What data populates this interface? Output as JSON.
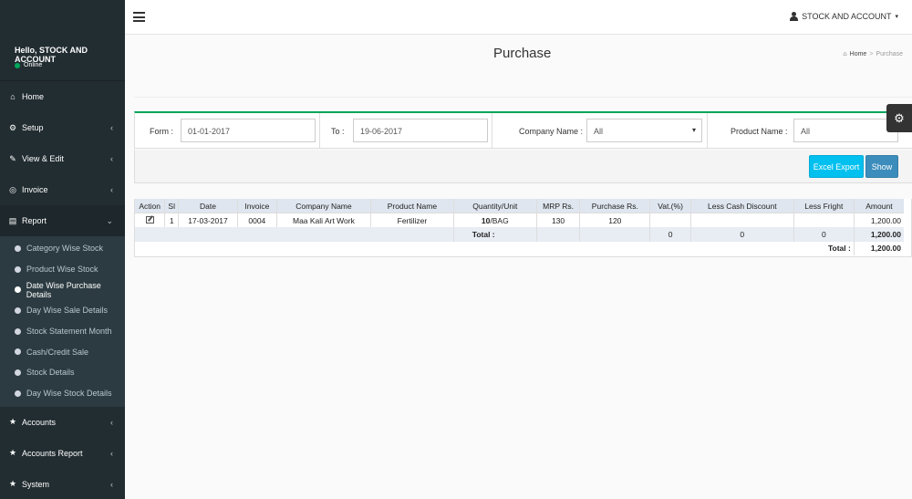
{
  "sidebar": {
    "greeting": "Hello, STOCK AND ACCOUNT",
    "status": "Online",
    "items": [
      {
        "label": "Home",
        "icon": "home-icon"
      },
      {
        "label": "Setup",
        "icon": "cogs-icon"
      },
      {
        "label": "View & Edit",
        "icon": "edit-icon"
      },
      {
        "label": "Invoice",
        "icon": "fingerprint-icon"
      },
      {
        "label": "Report",
        "icon": "file-icon"
      },
      {
        "label": "Accounts",
        "icon": "star-icon"
      },
      {
        "label": "Accounts Report",
        "icon": "star-icon"
      },
      {
        "label": "System",
        "icon": "star-icon"
      }
    ],
    "report_sub": [
      "Category Wise Stock",
      "Product Wise Stock",
      "Date Wise Purchase Details",
      "Day Wise Sale Details",
      "Stock Statement Month",
      "Cash/Credit Sale",
      "Stock Details",
      "Day Wise Stock Details"
    ]
  },
  "header": {
    "user": "STOCK AND ACCOUNT"
  },
  "page": {
    "title": "Purchase",
    "breadcrumb_home": "Home",
    "breadcrumb_current": "Purchase"
  },
  "filters": {
    "from_label": "Form :",
    "from_value": "01-01-2017",
    "to_label": "To :",
    "to_value": "19-06-2017",
    "company_label": "Company Name :",
    "company_value": "All",
    "product_label": "Product Name :",
    "product_value": "All"
  },
  "buttons": {
    "excel": "Excel Export",
    "show": "Show"
  },
  "table": {
    "headers": [
      "Action",
      "Sl",
      "Date",
      "Invoice",
      "Company Name",
      "Product Name",
      "Quantity/Unit",
      "MRP Rs.",
      "Purchase Rs.",
      "Vat.(%)",
      "Less Cash Discount",
      "Less Fright",
      "Amount"
    ],
    "row": {
      "sl": "1",
      "date": "17-03-2017",
      "invoice": "0004",
      "company": "Maa Kali Art Work",
      "product": "Fertilizer",
      "qty": "10",
      "unit": "/BAG",
      "mrp": "130",
      "purchase": "120",
      "vat": "",
      "cash_discount": "",
      "fright": "",
      "amount": "1,200.00"
    },
    "subtotal": {
      "label": "Total :",
      "vat": "0",
      "cash_discount": "0",
      "fright": "0",
      "amount": "1,200.00"
    },
    "grand_total": {
      "label": "Total :",
      "amount": "1,200.00"
    }
  }
}
